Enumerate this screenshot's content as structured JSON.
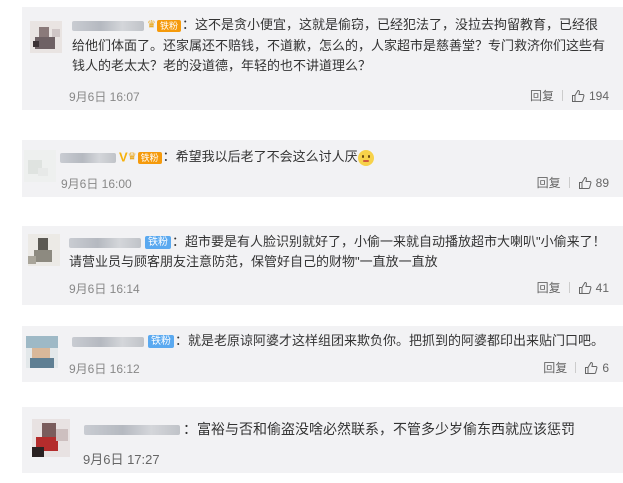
{
  "comments": [
    {
      "badge": "铁粉",
      "body": "：这不是贪小便宜，这就是偷窃，已经犯法了，没拉去拘留教育，已经很给他们体面了。还家属还不赔钱，不道歉，怎么的，人家超市是慈善堂？专门救济你们这些有钱人的老太太？老的没道德，年轻的也不讲道理么？",
      "time": "9月6日 16:07",
      "reply": "回复",
      "likes": "194"
    },
    {
      "badge": "铁粉",
      "body": "：希望我以后老了不会这么讨人厌",
      "time": "9月6日 16:00",
      "reply": "回复",
      "likes": "89"
    },
    {
      "badge": "铁粉",
      "body": "：超市要是有人脸识别就好了，小偷一来就自动播放超市大喇叭\"小偷来了！请营业员与顾客朋友注意防范，保管好自己的财物\"一直放一直放",
      "time": "9月6日 16:14",
      "reply": "回复",
      "likes": "41"
    },
    {
      "badge": "铁粉",
      "body": "：就是老原谅阿婆才这样组团来欺负你。把抓到的阿婆都印出来贴门口吧。",
      "time": "9月6日 16:12",
      "reply": "回复",
      "likes": "6"
    },
    {
      "body": "：富裕与否和偷盗没啥必然联系，不管多少岁偷东西就应该惩罚",
      "time": "9月6日 17:27"
    }
  ],
  "icons": {
    "like": "thumbs-up-icon",
    "emoji": "smug-face-emoji"
  },
  "colors": {
    "card_bg": "#f2f2f4",
    "badge_gold": "#f59a0b",
    "badge_blue": "#5aa9f0"
  }
}
